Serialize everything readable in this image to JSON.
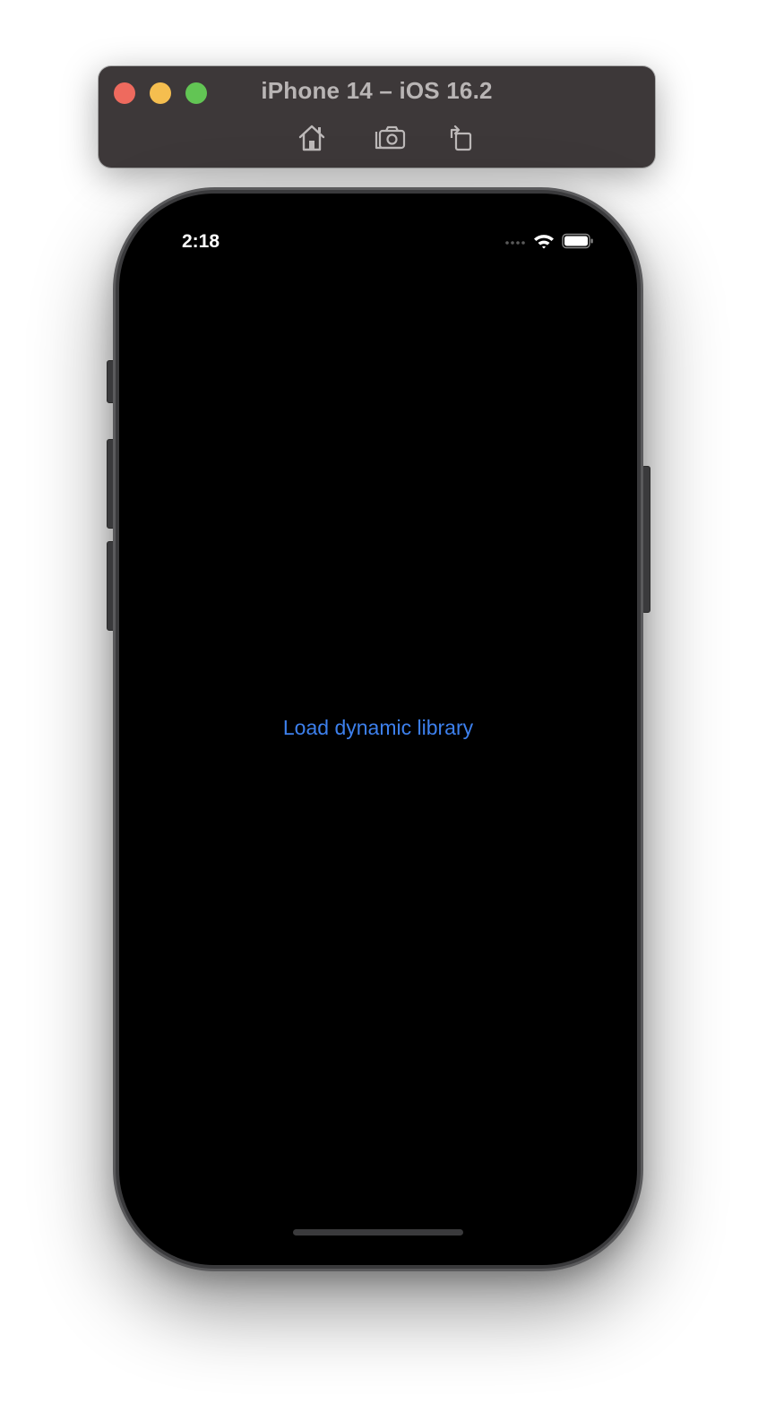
{
  "window": {
    "title": "iPhone 14 – iOS 16.2",
    "controls": [
      "close",
      "minimize",
      "zoom"
    ],
    "toolbar": [
      {
        "name": "home",
        "icon": "home-icon"
      },
      {
        "name": "screenshot",
        "icon": "camera-icon"
      },
      {
        "name": "rotate",
        "icon": "rotate-icon"
      }
    ]
  },
  "status_bar": {
    "time": "2:18",
    "icons": [
      "cellular-signal-icon",
      "wifi-icon",
      "battery-icon"
    ]
  },
  "app": {
    "button_label": "Load dynamic library",
    "button_color": "#3d80ed",
    "background": "#000000"
  }
}
